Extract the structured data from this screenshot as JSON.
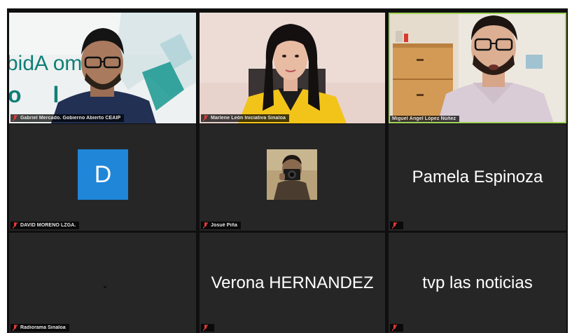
{
  "meeting": {
    "participants": [
      {
        "name": "Gabriel Mercado. Gobierno Abierto CEAIP",
        "type": "video",
        "active_speaker": false
      },
      {
        "name": "Marlene León Iniciativa Sinaloa",
        "type": "video",
        "active_speaker": false
      },
      {
        "name": "Miguel Ángel López Núñez",
        "type": "video",
        "active_speaker": true
      },
      {
        "name": "DAVID MORENO LZGA.",
        "type": "avatar",
        "avatar_letter": "D"
      },
      {
        "name": "Josué Piña",
        "type": "photo"
      },
      {
        "name": "Pamela Espinoza",
        "type": "name-only",
        "display_name": "Pamela Espinoza"
      },
      {
        "name": "Radiorama Sinaloa",
        "type": "blank"
      },
      {
        "name": "",
        "type": "name-only",
        "display_name": "Verona HERNANDEZ"
      },
      {
        "name": "",
        "type": "name-only",
        "display_name": "tvp las noticias"
      }
    ],
    "background_text": {
      "line1": "bidA omo",
      "line2": "o l a"
    }
  },
  "colors": {
    "avatar_blue": "#1f86d8",
    "active_speaker_border": "#9fd356",
    "muted_mic": "#e53935",
    "tile_bg": "#262626"
  },
  "icons": {
    "mic": "muted-mic-icon"
  }
}
